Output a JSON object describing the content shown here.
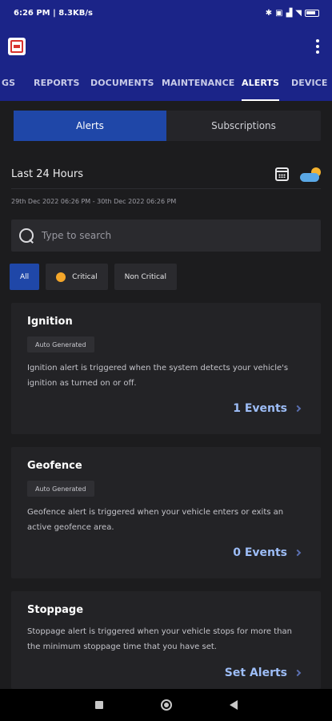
{
  "status_bar": {
    "time_speed": "6:26 PM | 8.3KB/s"
  },
  "tabs": [
    {
      "label": "GS"
    },
    {
      "label": "REPORTS"
    },
    {
      "label": "DOCUMENTS"
    },
    {
      "label": "MAINTENANCE"
    },
    {
      "label": "ALERTS"
    },
    {
      "label": "DEVICE"
    }
  ],
  "segment": {
    "alerts": "Alerts",
    "subscriptions": "Subscriptions"
  },
  "range": {
    "title": "Last 24 Hours",
    "dates": "29th Dec 2022 06:26 PM - 30th Dec 2022 06:26 PM"
  },
  "search": {
    "placeholder": "Type to search"
  },
  "filters": {
    "all": "All",
    "critical": "Critical",
    "non_critical": "Non Critical"
  },
  "cards": [
    {
      "title": "Ignition",
      "badge": "Auto Generated",
      "description": "Ignition alert is triggered when the system detects your vehicle's ignition as turned on or off.",
      "action": "1 Events"
    },
    {
      "title": "Geofence",
      "badge": "Auto Generated",
      "description": "Geofence alert is triggered when your vehicle enters or exits an active geofence area.",
      "action": "0 Events"
    },
    {
      "title": "Stoppage",
      "description": "Stoppage alert is triggered when your vehicle stops for more than the minimum stoppage time that you have set.",
      "action": "Set Alerts"
    }
  ]
}
